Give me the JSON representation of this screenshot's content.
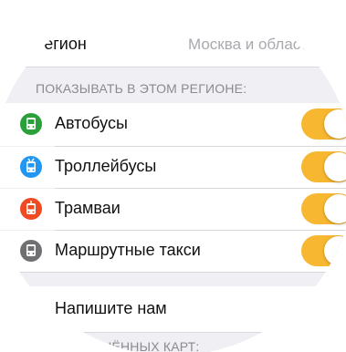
{
  "region": {
    "label": "Регион",
    "value": "Москва и область"
  },
  "transport_section": {
    "header": "Показывать в этом регионе:",
    "items": [
      {
        "label": "Автобусы",
        "icon": "bus-icon",
        "color": "#2aa03b",
        "enabled": true
      },
      {
        "label": "Троллейбусы",
        "icon": "trolleybus-icon",
        "color": "#2196f3",
        "enabled": true
      },
      {
        "label": "Трамваи",
        "icon": "tram-icon",
        "color": "#f04a23",
        "enabled": true
      },
      {
        "label": "Маршрутные такси",
        "icon": "minibus-icon",
        "color": "#707072",
        "enabled": true
      }
    ]
  },
  "feedback": {
    "label": "Напишите нам"
  },
  "saved_maps": {
    "header": "Сохранённых карт:"
  },
  "colors": {
    "toggle_on": "#f7b731",
    "background": "#efeff4"
  }
}
